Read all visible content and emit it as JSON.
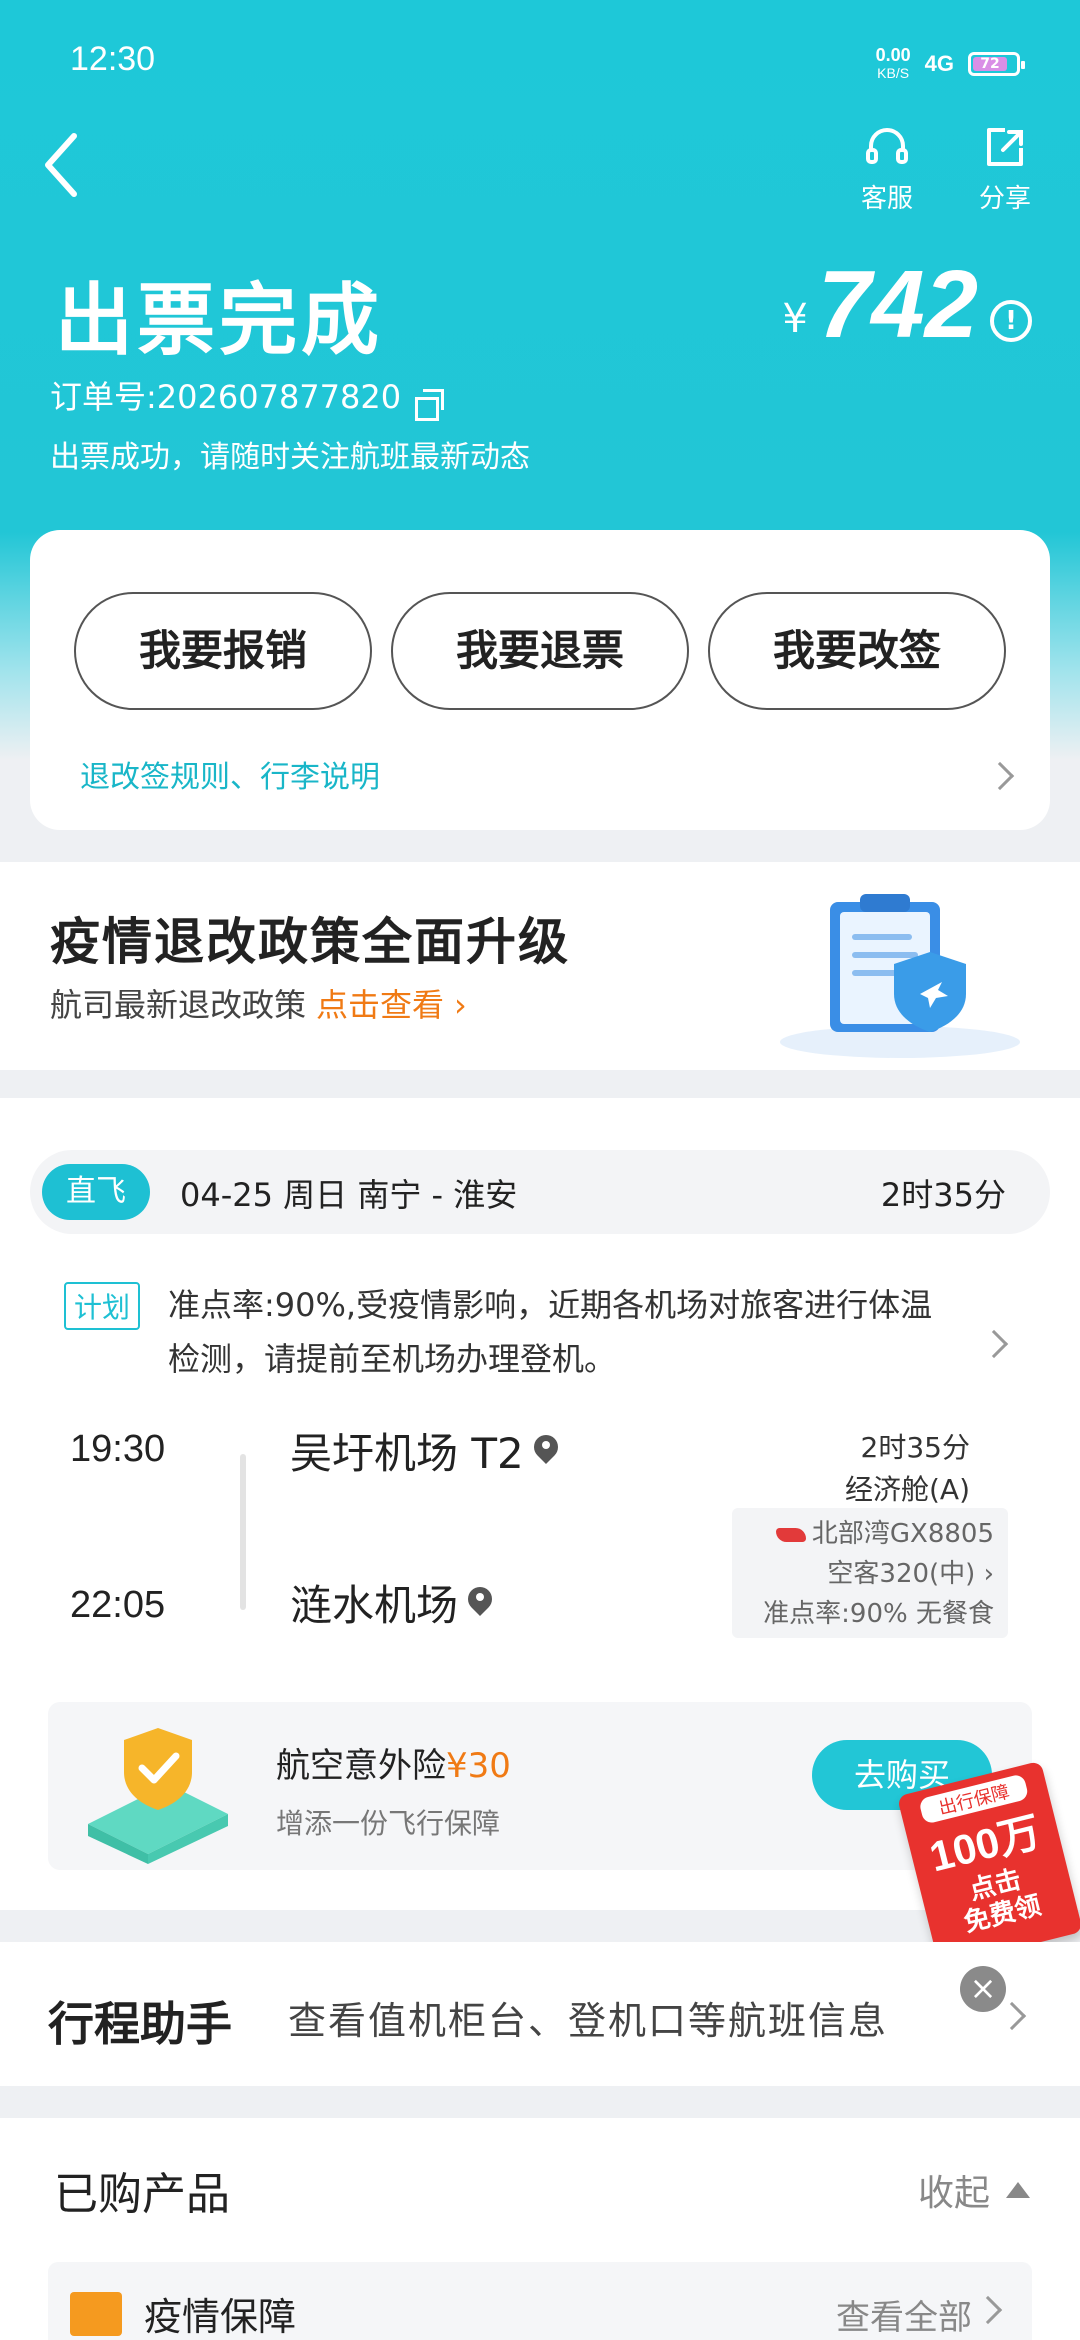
{
  "status_bar": {
    "time": "12:30",
    "net_speed": "0.00",
    "net_unit": "KB/S",
    "signal": "4G",
    "battery": "72"
  },
  "header": {
    "service_label": "客服",
    "share_label": "分享",
    "title": "出票完成",
    "price_symbol": "¥",
    "price": "742",
    "order_no": "订单号:202607877820",
    "subtitle": "出票成功，请随时关注航班最新动态"
  },
  "actions": {
    "reimburse": "我要报销",
    "refund": "我要退票",
    "change": "我要改签",
    "rules_link": "退改签规则、行李说明"
  },
  "policy": {
    "title": "疫情退改政策全面升级",
    "sub": "航司最新退改政策",
    "link": "点击查看"
  },
  "flight": {
    "tag": "直飞",
    "date_route": "04-25 周日 南宁 - 淮安",
    "duration": "2时35分",
    "plan_tag": "计划",
    "plan_text": "准点率:90%,受疫情影响，近期各机场对旅客进行体温检测，请提前至机场办理登机。",
    "dep_time": "19:30",
    "arr_time": "22:05",
    "dep_airport": "吴圩机场 T2",
    "arr_airport": "涟水机场",
    "meta_duration": "2时35分",
    "cabin": "经济舱(A)",
    "flight_no": "北部湾GX8805",
    "aircraft": "空客320(中)",
    "punctuality": "准点率:90% 无餐食"
  },
  "insurance": {
    "name": "航空意外险",
    "price": "¥30",
    "sub": "增添一份飞行保障",
    "button": "去购买"
  },
  "promo": {
    "top": "出行保障",
    "big": "100万",
    "line1": "点击",
    "line2": "免费领"
  },
  "assistant": {
    "title": "行程助手",
    "text": "查看值机柜台、登机口等航班信息",
    "close": "×"
  },
  "products": {
    "title": "已购产品",
    "collapse": "收起",
    "item_name": "疫情保障",
    "item_link": "查看全部"
  },
  "colors": {
    "brand": "#1ec8d8",
    "accent_orange": "#f07a14",
    "promo_red": "#e8322e"
  }
}
